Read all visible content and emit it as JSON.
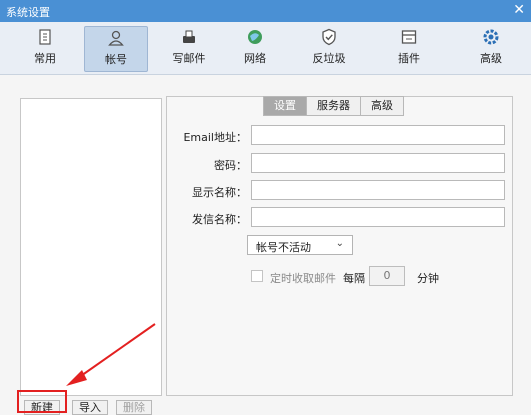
{
  "window": {
    "title": "系统设置",
    "close_glyph": "✕"
  },
  "toolbar": {
    "items": [
      {
        "label": "常用",
        "icon": "general-icon"
      },
      {
        "label": "帐号",
        "icon": "account-icon",
        "active": true
      },
      {
        "label": "写邮件",
        "icon": "compose-icon"
      },
      {
        "label": "网络",
        "icon": "network-icon"
      },
      {
        "label": "反垃圾",
        "icon": "antispam-shield-icon"
      },
      {
        "label": "插件",
        "icon": "plugin-icon"
      },
      {
        "label": "高级",
        "icon": "advanced-gear-icon"
      }
    ]
  },
  "tabs": [
    {
      "label": "设置",
      "active": true
    },
    {
      "label": "服务器"
    },
    {
      "label": "高级"
    }
  ],
  "form": {
    "email_label": "Email地址：",
    "email_value": "",
    "password_label": "密码：",
    "password_value": "",
    "display_name_label": "显示名称：",
    "display_name_value": "",
    "sender_name_label": "发信名称：",
    "sender_name_value": "",
    "account_status_selected": "帐号不活动",
    "timer_label": "定时收取邮件",
    "every_label": "每隔",
    "interval_value": "0",
    "minutes_label": "分钟"
  },
  "buttons": {
    "new": "新建",
    "import": "导入",
    "delete": "删除"
  },
  "colors": {
    "titlebar": "#4a90d4",
    "highlight": "#e32020"
  }
}
